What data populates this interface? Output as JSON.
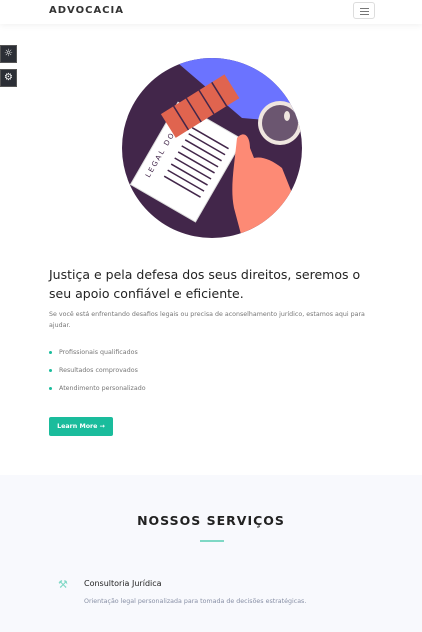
{
  "nav": {
    "brand": "ADVOCACIA",
    "menu_icon": "hamburger-icon"
  },
  "side_tools": [
    {
      "icon": "sun-icon"
    },
    {
      "icon": "gear-icon"
    }
  ],
  "hero": {
    "illustration_text": "LEGAL DOCUMENT",
    "title": "Justiça e pela defesa dos seus direitos, seremos o seu apoio confiável e eficiente.",
    "lead": "Se você está enfrentando desafios legais ou precisa de aconselhamento jurídico, estamos aqui para ajudar.",
    "features": [
      "Profissionais qualificados",
      "Resultados comprovados",
      "Atendimento personalizado"
    ],
    "cta": "Learn More →"
  },
  "services": {
    "title": "NOSSOS SERVIÇOS",
    "items": [
      {
        "icon": "gavel-icon",
        "name": "Consultoria Jurídica",
        "description": "Orientação legal personalizada para tomada de decisões estratégicas."
      }
    ]
  },
  "colors": {
    "accent": "#1abc9c",
    "dark": "#42264a",
    "blue": "#6b73ff",
    "orange": "#e0644f"
  }
}
